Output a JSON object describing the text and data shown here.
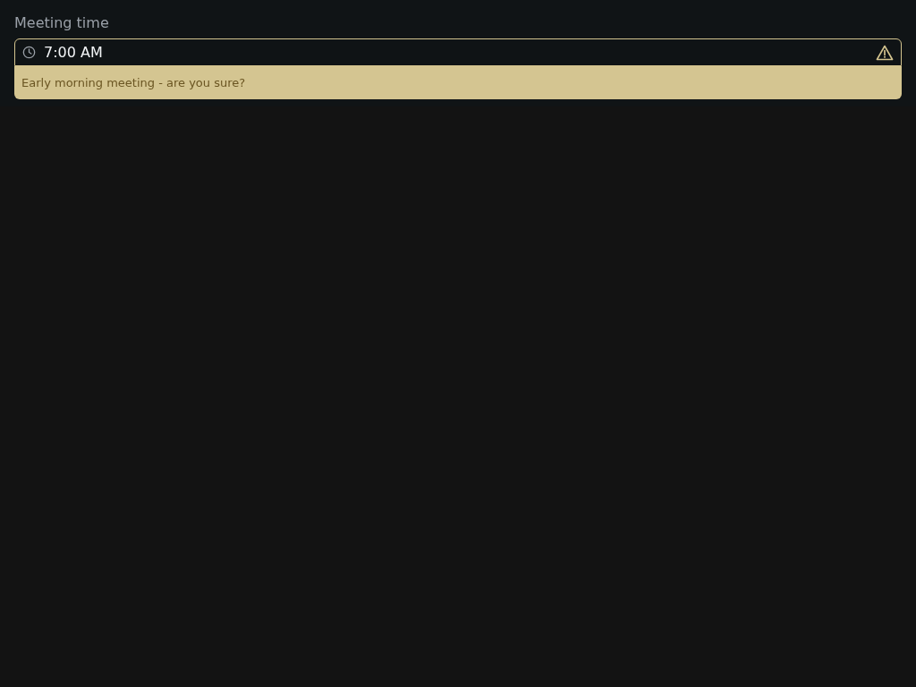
{
  "field": {
    "label": "Meeting time",
    "value": "7:00 AM",
    "validation": {
      "kind": "warning",
      "message": "Early morning meeting - are you sure?"
    }
  }
}
